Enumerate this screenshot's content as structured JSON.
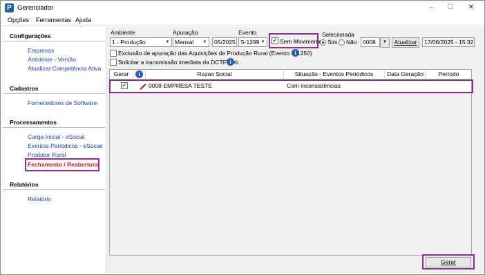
{
  "window": {
    "title": "Gerenciador",
    "app_icon_letter": "P",
    "minimize": "–",
    "maximize": "☐",
    "close": "✕"
  },
  "menu": {
    "items": [
      "Opções",
      "Ferramentas",
      "Ajuda"
    ]
  },
  "sidebar": {
    "sections": [
      {
        "title": "Configurações",
        "items": [
          "Empresas",
          "Ambiente - Versão",
          "Atualizar Competência Ativa"
        ]
      },
      {
        "title": "Cadastros",
        "items": [
          "Fornecedores de Software"
        ]
      },
      {
        "title": "Processamentos",
        "items": [
          "Carga Inicial - eSocial",
          "Eventos Periódicos - eSocial",
          "Produtor Rural",
          "Fechamento / Reabertura"
        ]
      },
      {
        "title": "Relatórios",
        "items": [
          "Relatório"
        ]
      }
    ]
  },
  "filters": {
    "ambiente_label": "Ambiente",
    "ambiente_value": "1 - Produção",
    "apuracao_label": "Apuração",
    "apuracao_value": "Mensal",
    "periodo_value": "05/2025",
    "evento_label": "Evento",
    "evento_value": "S-1299",
    "sem_movimento_label": "Sem Movimento",
    "sem_movimento_checked": true,
    "selecionada_label": "Selecionada",
    "sim_label": "Sim",
    "nao_label": "Não",
    "selected_option": "Sim",
    "company_code": "0008",
    "atualizar_label": "Atualizar",
    "datetime_value": "17/06/2025 - 15:32",
    "exclusao_label": "Exclusão de apuração das Aquisições de Produção Rural (Evento S-1250)",
    "solicitar_label": "Solicitar a transmissão imediata da DCTFWeb"
  },
  "grid": {
    "columns": [
      "Gerar",
      "Razao Social",
      "Situação - Eventos Periódicos",
      "Data Geração",
      "Período"
    ],
    "rows": [
      {
        "checked": true,
        "razao_social": "0008 EMPRESA TESTE",
        "situacao": "Com inconsistências",
        "data_geracao": "",
        "periodo": ""
      }
    ]
  },
  "actions": {
    "gerar_label": "Gerar"
  },
  "colors": {
    "link": "#1c3fb8",
    "active_link": "#d8182a",
    "highlight": "#8b2f8f"
  }
}
